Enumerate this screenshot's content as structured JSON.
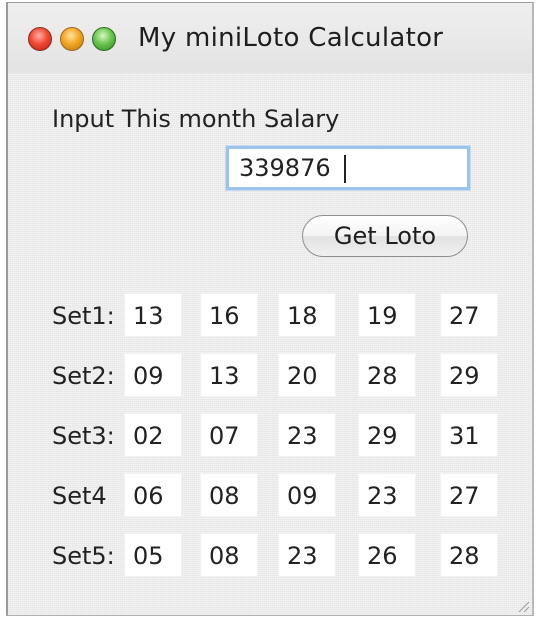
{
  "window": {
    "title": "My miniLoto Calculator"
  },
  "form": {
    "prompt_label": "Input This month Salary",
    "salary_value": "339876",
    "get_loto_label": "Get Loto"
  },
  "sets": [
    {
      "label": "Set1:",
      "numbers": [
        "13",
        "16",
        "18",
        "19",
        "27"
      ]
    },
    {
      "label": "Set2:",
      "numbers": [
        "09",
        "13",
        "20",
        "28",
        "29"
      ]
    },
    {
      "label": "Set3:",
      "numbers": [
        "02",
        "07",
        "23",
        "29",
        "31"
      ]
    },
    {
      "label": "Set4",
      "numbers": [
        "06",
        "08",
        "09",
        "23",
        "27"
      ]
    },
    {
      "label": "Set5:",
      "numbers": [
        "05",
        "08",
        "23",
        "26",
        "28"
      ]
    }
  ],
  "colors": {
    "focus_ring": "#9cc3ea",
    "close": "#f04a34",
    "minimize": "#f4a623",
    "maximize": "#6cc54e"
  }
}
